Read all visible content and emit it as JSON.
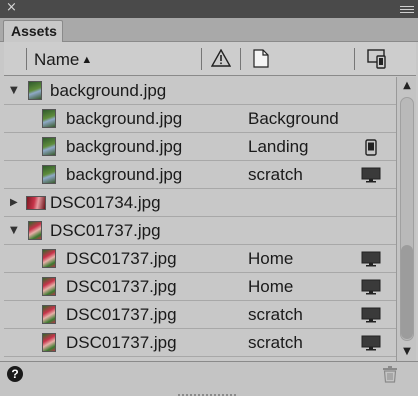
{
  "window": {
    "close_icon": "close-icon",
    "menu_icon": "panel-menu-icon"
  },
  "tabs": [
    {
      "label": "Assets"
    }
  ],
  "columns": {
    "name": "Name",
    "sort_icon": "sort-ascending-icon",
    "warning_icon": "warning-icon",
    "page_icon": "page-icon",
    "device_icon": "devices-icon"
  },
  "rows": [
    {
      "kind": "group",
      "expanded": true,
      "name": "background.jpg",
      "thumb": "green"
    },
    {
      "kind": "item",
      "name": "background.jpg",
      "page": "Background",
      "device": "",
      "thumb": "green"
    },
    {
      "kind": "item",
      "name": "background.jpg",
      "page": "Landing",
      "device": "phone-icon",
      "thumb": "green"
    },
    {
      "kind": "item",
      "name": "background.jpg",
      "page": "scratch",
      "device": "monitor-icon",
      "thumb": "green"
    },
    {
      "kind": "group",
      "expanded": false,
      "name": "DSC01734.jpg",
      "thumb": "wide"
    },
    {
      "kind": "group",
      "expanded": true,
      "name": "DSC01737.jpg",
      "thumb": "flower"
    },
    {
      "kind": "item",
      "name": "DSC01737.jpg",
      "page": "Home",
      "device": "monitor-icon",
      "thumb": "flower"
    },
    {
      "kind": "item",
      "name": "DSC01737.jpg",
      "page": "Home",
      "device": "monitor-icon",
      "thumb": "flower"
    },
    {
      "kind": "item",
      "name": "DSC01737.jpg",
      "page": "scratch",
      "device": "monitor-icon",
      "thumb": "flower"
    },
    {
      "kind": "item",
      "name": "DSC01737.jpg",
      "page": "scratch",
      "device": "monitor-icon",
      "thumb": "flower"
    }
  ],
  "footer": {
    "help_label": "?",
    "help_icon": "help-icon",
    "trash_icon": "trash-icon"
  },
  "scroll": {
    "position": 0.75
  }
}
